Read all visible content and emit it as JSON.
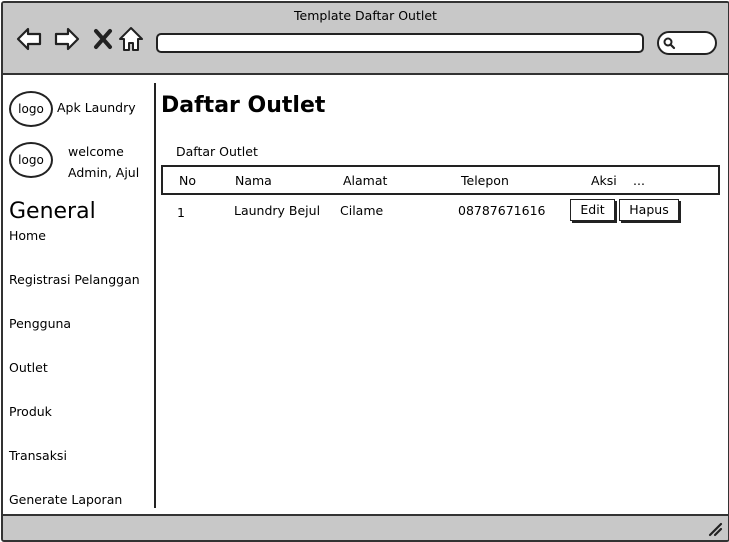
{
  "window": {
    "title": "Template Daftar Outlet"
  },
  "nav_icons": [
    "back-arrow-icon",
    "forward-arrow-icon",
    "close-icon",
    "home-icon"
  ],
  "url": {
    "value": ""
  },
  "app": {
    "logo_text": "logo",
    "name": "Apk Laundry"
  },
  "user": {
    "logo_text": "logo",
    "greeting": "welcome",
    "name": "Admin, Ajul"
  },
  "sidebar": {
    "heading": "General",
    "items": [
      {
        "label": "Home"
      },
      {
        "label": "Registrasi Pelanggan"
      },
      {
        "label": "Pengguna"
      },
      {
        "label": "Outlet"
      },
      {
        "label": "Produk"
      },
      {
        "label": "Transaksi"
      },
      {
        "label": "Generate Laporan"
      }
    ]
  },
  "main": {
    "title": "Daftar Outlet",
    "section": "Daftar Outlet",
    "table": {
      "headers": [
        "No",
        "Nama",
        "Alamat",
        "Telepon",
        "Aksi",
        "..."
      ],
      "rows": [
        {
          "no": "1",
          "nama": "Laundry Bejul",
          "alamat": "Cilame",
          "telepon": "08787671616",
          "edit_label": "Edit",
          "hapus_label": "Hapus"
        }
      ]
    }
  }
}
